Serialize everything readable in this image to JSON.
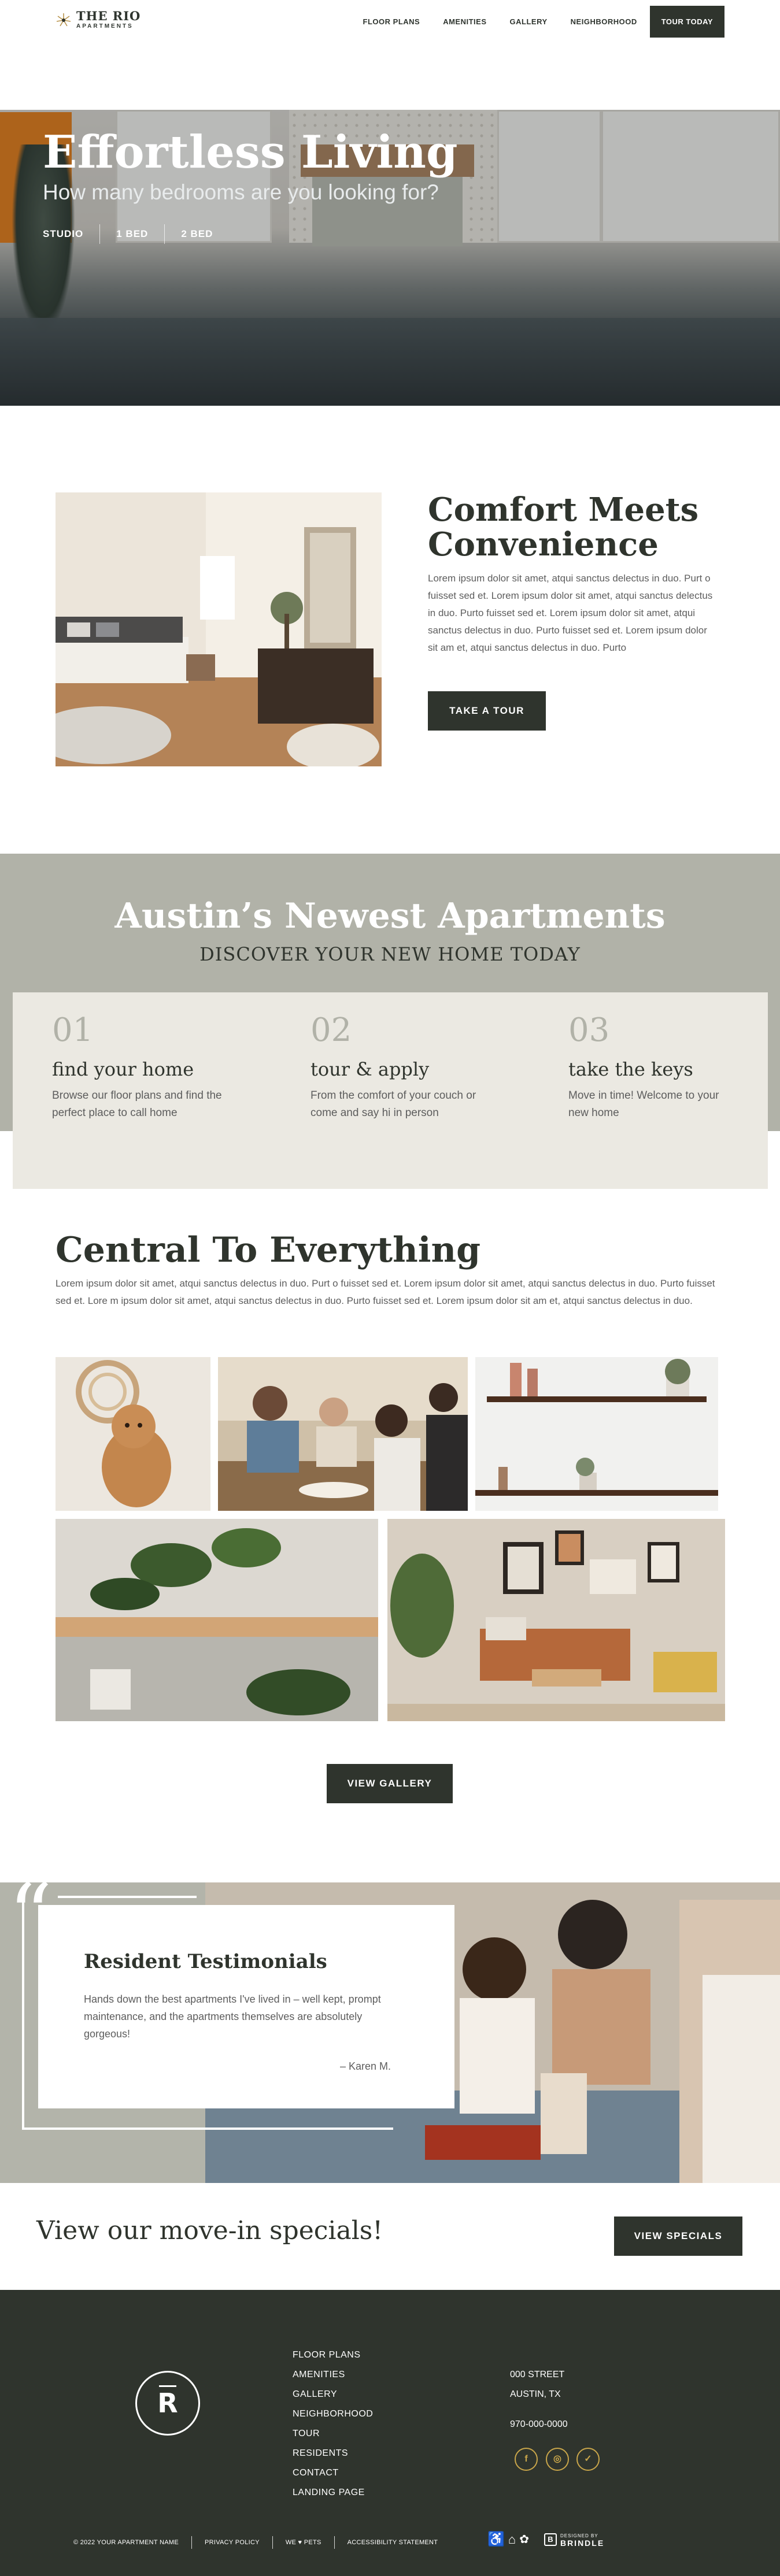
{
  "header": {
    "logo_title": "THE RIO",
    "logo_sub": "APARTMENTS",
    "nav": [
      "FLOOR PLANS",
      "AMENITIES",
      "GALLERY",
      "NEIGHBORHOOD"
    ],
    "cta": "TOUR TODAY"
  },
  "hero": {
    "title": "Effortless Living",
    "subtitle": "How many bedrooms are you looking for?",
    "tabs": [
      "STUDIO",
      "1 BED",
      "2 BED"
    ]
  },
  "comfort": {
    "title": "Comfort Meets Convenience",
    "body": "Lorem ipsum dolor sit amet, atqui sanctus delectus in duo. Purt o fuisset sed et. Lorem ipsum dolor sit amet, atqui sanctus delectus in duo. Purto fuisset sed et. Lorem ipsum dolor sit amet, atqui sanctus delectus in duo. Purto fuisset sed et. Lorem ipsum dolor sit am et, atqui sanctus delectus in duo. Purto",
    "button": "TAKE A TOUR"
  },
  "austin": {
    "title": "Austin’s Newest Apartments",
    "subtitle": "DISCOVER YOUR NEW HOME TODAY",
    "steps": [
      {
        "num": "01",
        "title": "find your home",
        "body": "Browse our floor plans and find the perfect place to call home"
      },
      {
        "num": "02",
        "title": "tour & apply",
        "body": "From the comfort of your couch or come and say hi in person"
      },
      {
        "num": "03",
        "title": "take the keys",
        "body": "Move in time! Welcome to your new home"
      }
    ]
  },
  "central": {
    "title": "Central To Everything",
    "body": "Lorem ipsum dolor sit amet, atqui sanctus delectus in duo. Purt o fuisset sed et. Lorem ipsum dolor sit amet, atqui sanctus delectus in duo. Purto fuisset sed et. Lore m ipsum dolor sit amet, atqui sanctus delectus in duo. Purto fuisset sed et. Lorem ipsum dolor sit am et, atqui sanctus delectus in duo.",
    "button": "VIEW GALLERY"
  },
  "testimonials": {
    "title": "Resident Testimonials",
    "body": "Hands down the best apartments I've lived in – well kept, prompt maintenance, and the apartments themselves are absolutely gorgeous!",
    "author": "– Karen M."
  },
  "specials": {
    "text": "View our move-in specials!",
    "button": "VIEW SPECIALS"
  },
  "footer": {
    "logo_letter": "R",
    "links": [
      "FLOOR PLANS",
      "AMENITIES",
      "GALLERY",
      "NEIGHBORHOOD",
      "TOUR",
      "RESIDENTS",
      "CONTACT",
      "LANDING PAGE"
    ],
    "address1": "000 STREET",
    "address2": "AUSTIN, TX",
    "phone": "970-000-0000",
    "copyright": "© 2022 YOUR APARTMENT NAME",
    "privacy": "PRIVACY POLICY",
    "pets": "WE ♥ PETS",
    "accessibility": "ACCESSIBILITY STATEMENT",
    "designed_by": "DESIGNED BY",
    "designer": "BRINDLE"
  },
  "colors": {
    "dark": "#2f342d",
    "sage": "#b1b2a8",
    "cream": "#ebe9e2",
    "gold": "#c9a64a"
  }
}
